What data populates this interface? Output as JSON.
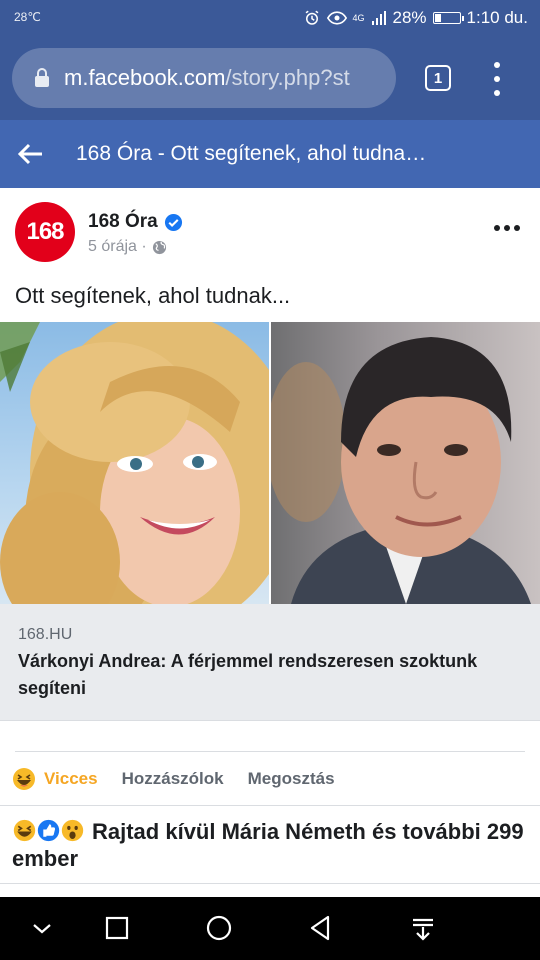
{
  "status_bar": {
    "left_text": "28℃",
    "network_label": "4G",
    "battery_text": "28%",
    "battery_level": 0.28,
    "time": "1:10 du."
  },
  "browser": {
    "url_domain": "m.facebook.com",
    "url_path": "/story.php?st",
    "tab_count": "1",
    "icons": [
      "lock-icon",
      "tab-switcher-icon",
      "overflow-menu-icon"
    ]
  },
  "fb_header": {
    "title": "168 Óra - Ott segítenek, ahol tudna…"
  },
  "post": {
    "avatar_text": "168",
    "page_name": "168 Óra",
    "time": "5 órája ·",
    "text": "Ott segítenek, ahol tudnak...",
    "link_domain": "168.HU",
    "link_title": "Várkonyi Andrea: A férjemmel rendszeresen szoktunk segíteni"
  },
  "actions": {
    "reaction_label": "Vicces",
    "comment_label": "Hozzászólok",
    "share_label": "Megosztás"
  },
  "reactions_summary": {
    "text": "Rajtad kívül Mária Németh és további 299 ember",
    "icons": [
      "haha-icon",
      "like-icon",
      "wow-icon"
    ]
  },
  "colors": {
    "fb_blue": "#3b5998",
    "fb_header_blue": "#4267b2",
    "brand_red": "#e2001a",
    "haha_yellow": "#f5a623"
  }
}
